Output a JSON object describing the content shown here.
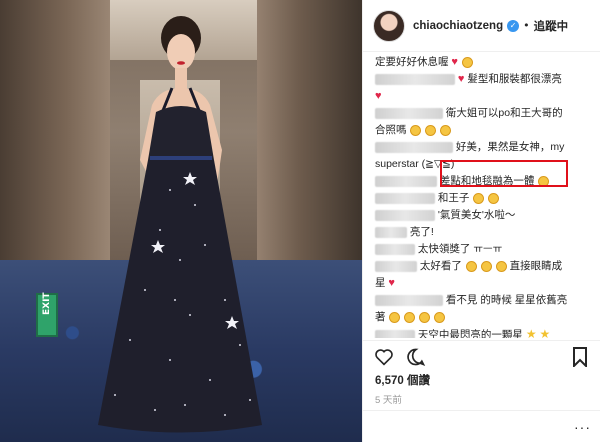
{
  "post": {
    "username": "chiaochiaotzeng",
    "verified_icon": "verified-badge-icon",
    "follow_separator": "•",
    "follow_label": "追蹤中"
  },
  "photo": {
    "exit_sign": "EXIT"
  },
  "comments": [
    {
      "text": "定要好好休息喔",
      "suffix": ""
    },
    {
      "text": "髮型和服裝都很漂亮",
      "suffix": ""
    },
    {
      "text": "",
      "suffix": ""
    },
    {
      "text": "衛大姐可以po和王大哥的",
      "suffix": ""
    },
    {
      "text": "合照嗎",
      "suffix": ""
    },
    {
      "text": "好美，果然是女神，my",
      "suffix": ""
    },
    {
      "text": "superstar (≧▽≦)",
      "suffix": ""
    },
    {
      "text": "差點和地毯融為一體",
      "suffix": ""
    },
    {
      "text": "和王子",
      "suffix": ""
    },
    {
      "text": "'氣質美女'水啦～",
      "suffix": ""
    },
    {
      "text": "亮了!",
      "suffix": ""
    },
    {
      "text": "太快領獎了 ㅠㅡㅠ",
      "suffix": ""
    },
    {
      "text": "太好看了",
      "suffix": "直接眼睛成"
    },
    {
      "text": "星",
      "suffix": ""
    },
    {
      "text": "看不見 的時候 星星依舊亮",
      "suffix": ""
    },
    {
      "text": "著",
      "suffix": ""
    },
    {
      "text": "天空中最閃亮的一顆星",
      "suffix": ""
    }
  ],
  "likes": "6,570 個讚",
  "date": "5 天前",
  "add_comment": "",
  "more_label": "···",
  "colors": {
    "accent_blue": "#3897f0",
    "highlight_red": "#e0101a",
    "heart_red": "#e0264a"
  }
}
